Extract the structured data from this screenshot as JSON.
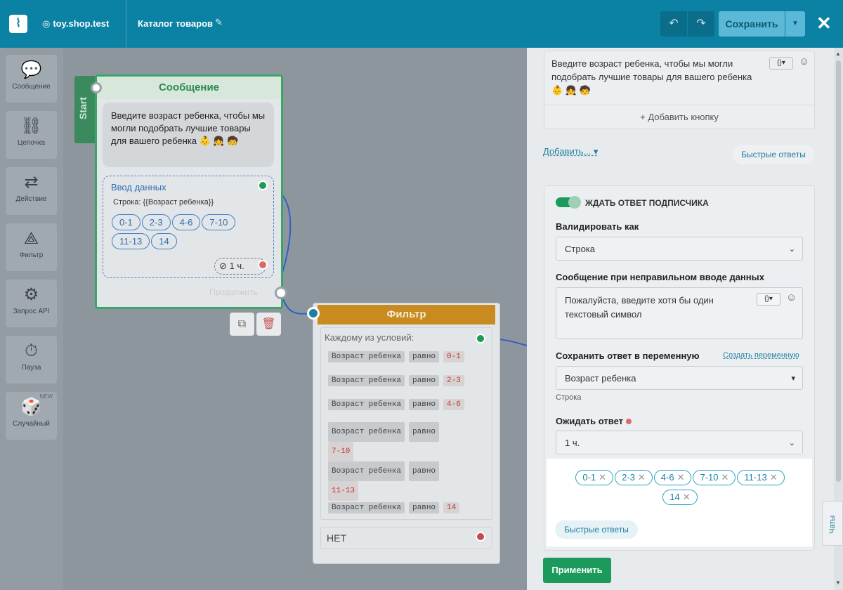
{
  "header": {
    "site_name": "toy.shop.test",
    "page_title": "Каталог товаров",
    "save_label": "Сохранить"
  },
  "toolbox": [
    {
      "label": "Сообщение",
      "icon": "message-icon",
      "glyph": "💬"
    },
    {
      "label": "Цепочка",
      "icon": "chain-icon",
      "glyph": "⛓"
    },
    {
      "label": "Действие",
      "icon": "action-icon",
      "glyph": "⇄"
    },
    {
      "label": "Фильтр",
      "icon": "filter-icon",
      "glyph": "⟁"
    },
    {
      "label": "Запрос API",
      "icon": "api-icon",
      "glyph": "⚙"
    },
    {
      "label": "Пауза",
      "icon": "pause-icon",
      "glyph": "⏱"
    },
    {
      "label": "Случайный",
      "icon": "random-icon",
      "glyph": "🎲",
      "badge": "NEW"
    }
  ],
  "message_node": {
    "start_label": "Start",
    "title": "Сообщение",
    "text": "Введите возраст ребенка, чтобы мы могли подобрать лучшие товары для вашего ребенка 👶 👧 🧒",
    "input_title": "Ввод данных",
    "input_type": "Строка: {{Возраст ребенка}}",
    "chips": [
      "0-1",
      "2-3",
      "4-6",
      "7-10",
      "11-13",
      "14"
    ],
    "timer": "1 ч.",
    "continue_label": "Продолжить"
  },
  "filter_node": {
    "title": "Фильтр",
    "condition_header": "Каждому из условий:",
    "conditions": [
      {
        "field": "Возраст ребенка",
        "op": "равно",
        "value": "0-1"
      },
      {
        "field": "Возраст ребенка",
        "op": "равно",
        "value": "2-3"
      },
      {
        "field": "Возраст ребенка",
        "op": "равно",
        "value": "4-6"
      },
      {
        "field": "Возраст ребенка",
        "op": "равно",
        "value": "7-10"
      },
      {
        "field": "Возраст ребенка",
        "op": "равно",
        "value": "11-13"
      },
      {
        "field": "Возраст ребенка",
        "op": "равно",
        "value": "14"
      }
    ],
    "no_label": "НЕТ"
  },
  "panel": {
    "message_text": "Введите возраст ребенка, чтобы мы могли подобрать лучшие товары для вашего ребенка 👶 👧 🧒",
    "add_button": "+ Добавить кнопку",
    "add_dropdown": "Добавить...",
    "quick_replies_link": "Быстрые ответы",
    "wait_toggle": "ЖДАТЬ ОТВЕТ ПОДПИСЧИКА",
    "validate_label": "Валидировать как",
    "validate_value": "Строка",
    "invalid_label": "Сообщение при неправильном вводе данных",
    "invalid_text": "Пожалуйста, введите хотя бы один текстовый символ",
    "save_var_label": "Сохранить ответ в переменную",
    "create_var_link": "Создать переменную",
    "var_value": "Возраст ребенка",
    "var_type": "Строка",
    "wait_label": "Ожидать ответ",
    "wait_value": "1 ч.",
    "quick_reply_chips": [
      "0-1",
      "2-3",
      "4-6",
      "7-10",
      "11-13",
      "14"
    ],
    "quick_replies_button": "Быстрые ответы",
    "apply_button": "Применить",
    "chats_tab": "Чаты"
  },
  "colors": {
    "header": "#0b82a3",
    "green": "#1c9a5c",
    "filter_header": "#c98a1f",
    "link": "#1f7fa0"
  }
}
